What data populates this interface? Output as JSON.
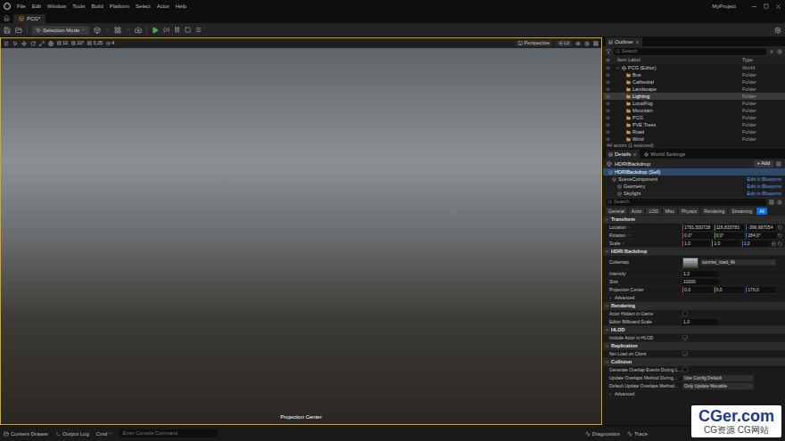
{
  "menu": {
    "items": [
      "File",
      "Edit",
      "Window",
      "Tools",
      "Build",
      "Platform",
      "Select",
      "Actor",
      "Help"
    ],
    "project": "MyProject"
  },
  "level_tab": {
    "label": "PCG*"
  },
  "toolbar": {
    "mode": "Selection Mode"
  },
  "viewport": {
    "snaps": [
      "10",
      "10°",
      "0,25"
    ],
    "camera_speed": "4",
    "view": "Perspective",
    "lit": "Lit",
    "label": "Projection Center"
  },
  "outliner": {
    "title": "Outliner",
    "search_placeholder": "Search",
    "columns": [
      "Item Label",
      "Type"
    ],
    "rows": [
      {
        "label": "PCG (Editor)",
        "type": "World",
        "kind": "world",
        "selected": false
      },
      {
        "label": "Bus",
        "type": "Folder",
        "kind": "folder",
        "selected": false
      },
      {
        "label": "Cathedral",
        "type": "Folder",
        "kind": "folder",
        "selected": false
      },
      {
        "label": "Landscape",
        "type": "Folder",
        "kind": "folder",
        "selected": false
      },
      {
        "label": "Lighting",
        "type": "Folder",
        "kind": "folder",
        "selected": true
      },
      {
        "label": "LocalFog",
        "type": "Folder",
        "kind": "folder",
        "selected": false
      },
      {
        "label": "Mountain",
        "type": "Folder",
        "kind": "folder",
        "selected": false
      },
      {
        "label": "PCG",
        "type": "Folder",
        "kind": "folder",
        "selected": false
      },
      {
        "label": "PVE Trees",
        "type": "Folder",
        "kind": "folder",
        "selected": false
      },
      {
        "label": "Road",
        "type": "Folder",
        "kind": "folder",
        "selected": false
      },
      {
        "label": "Wind",
        "type": "Folder",
        "kind": "folder",
        "selected": false
      }
    ],
    "footer": "44 actors (1 selected)"
  },
  "details": {
    "tabs": [
      {
        "label": "Details",
        "selected": true
      },
      {
        "label": "World Settings",
        "selected": false
      }
    ],
    "actor": "HDRIBackdrop",
    "add_button": "+ Add",
    "components": [
      {
        "name": "HDRIBackdrop (Self)",
        "selected": true
      },
      {
        "name": "SceneComponent",
        "link": "Edit in Blueprint",
        "selected": false
      },
      {
        "name": "Geometry",
        "link": "Edit in Blueprint",
        "selected": false
      },
      {
        "name": "Skylight",
        "link": "Edit in Blueprint",
        "selected": false
      }
    ],
    "search_placeholder": "Search",
    "filters": [
      {
        "label": "General",
        "selected": false
      },
      {
        "label": "Actor",
        "selected": false
      },
      {
        "label": "LOD",
        "selected": false
      },
      {
        "label": "Misc",
        "selected": false
      },
      {
        "label": "Physics",
        "selected": false
      },
      {
        "label": "Rendering",
        "selected": false
      },
      {
        "label": "Streaming",
        "selected": false
      },
      {
        "label": "All",
        "selected": true
      }
    ],
    "sections": [
      {
        "title": "Transform",
        "rows": [
          {
            "kind": "vector",
            "label": "Location",
            "values": [
              "1791,500728",
              "116,833783",
              "-396,687054"
            ]
          },
          {
            "kind": "vector",
            "label": "Rotation",
            "values": [
              "0,0°",
              "0,0°",
              "284,0°"
            ]
          },
          {
            "kind": "scale",
            "label": "Scale",
            "values": [
              "1,0",
              "1,0",
              "1,0"
            ]
          }
        ]
      },
      {
        "title": "HDRI Backdrop",
        "rows": [
          {
            "kind": "asset",
            "label": "Cubemap",
            "value": "sunrise_road_4k"
          },
          {
            "kind": "number",
            "label": "Intensity",
            "value": "1,0"
          },
          {
            "kind": "number",
            "label": "Size",
            "value": "10000"
          },
          {
            "kind": "triple",
            "label": "Projection Center",
            "values": [
              "0,0",
              "0,0",
              "170,0"
            ]
          },
          {
            "kind": "expander",
            "label": "Advanced"
          }
        ]
      },
      {
        "title": "Rendering",
        "rows": [
          {
            "kind": "checkbox",
            "label": "Actor Hidden in Game",
            "checked": false
          },
          {
            "kind": "number",
            "label": "Editor Billboard Scale",
            "value": "1,0"
          }
        ]
      },
      {
        "title": "HLOD",
        "rows": [
          {
            "kind": "checkbox",
            "label": "Include Actor in HLOD",
            "checked": true
          }
        ]
      },
      {
        "title": "Replication",
        "rows": [
          {
            "kind": "checkbox",
            "label": "Net Load on Client",
            "checked": true
          }
        ]
      },
      {
        "title": "Collision",
        "rows": [
          {
            "kind": "checkbox",
            "label": "Generate Overlap Events During L…",
            "checked": false
          },
          {
            "kind": "select",
            "label": "Update Overlaps Method During…",
            "value": "Use Config Default"
          },
          {
            "kind": "select",
            "label": "Default Update Overlaps Method…",
            "value": "Only Update Movable"
          },
          {
            "kind": "expander",
            "label": "Advanced"
          }
        ]
      }
    ]
  },
  "status_bar": {
    "items": [
      "Content Drawer",
      "Output Log"
    ],
    "cmd": "Cmd",
    "console_placeholder": "Enter Console Command",
    "right": [
      "Diagnostics",
      "Trace"
    ]
  },
  "watermark": {
    "title": "CGer.com",
    "subtitle": "CG资源 CG网站"
  }
}
